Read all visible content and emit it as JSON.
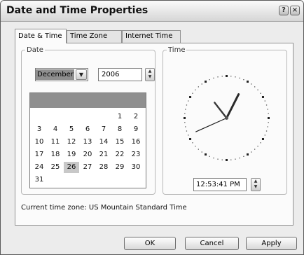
{
  "window": {
    "title": "Date and Time Properties",
    "help_label": "?",
    "close_label": "×"
  },
  "tabs": [
    {
      "label": "Date & Time",
      "active": true
    },
    {
      "label": "Time Zone",
      "active": false
    },
    {
      "label": "Internet Time",
      "active": false
    }
  ],
  "date": {
    "group_label": "Date",
    "month": "December",
    "month_dropdown_icon": "chevron-down-icon",
    "year": "2006",
    "selected_day": 26,
    "calendar_rows": [
      [
        "",
        "",
        "",
        "",
        "",
        "1",
        "2"
      ],
      [
        "3",
        "4",
        "5",
        "6",
        "7",
        "8",
        "9"
      ],
      [
        "10",
        "11",
        "12",
        "13",
        "14",
        "15",
        "16"
      ],
      [
        "17",
        "18",
        "19",
        "20",
        "21",
        "22",
        "23"
      ],
      [
        "24",
        "25",
        "26",
        "27",
        "28",
        "29",
        "30"
      ],
      [
        "31",
        "",
        "",
        "",
        "",
        "",
        ""
      ]
    ]
  },
  "time": {
    "group_label": "Time",
    "value": "12:53:41 PM",
    "clock": {
      "hours": 12,
      "minutes": 53,
      "seconds": 41
    }
  },
  "timezone_text": "Current time zone:  US Mountain Standard Time",
  "buttons": {
    "ok": "OK",
    "cancel": "Cancel",
    "apply": "Apply"
  },
  "colors": {
    "selection": "#8f8f8f",
    "selected_day_bg": "#c8c8c8"
  }
}
